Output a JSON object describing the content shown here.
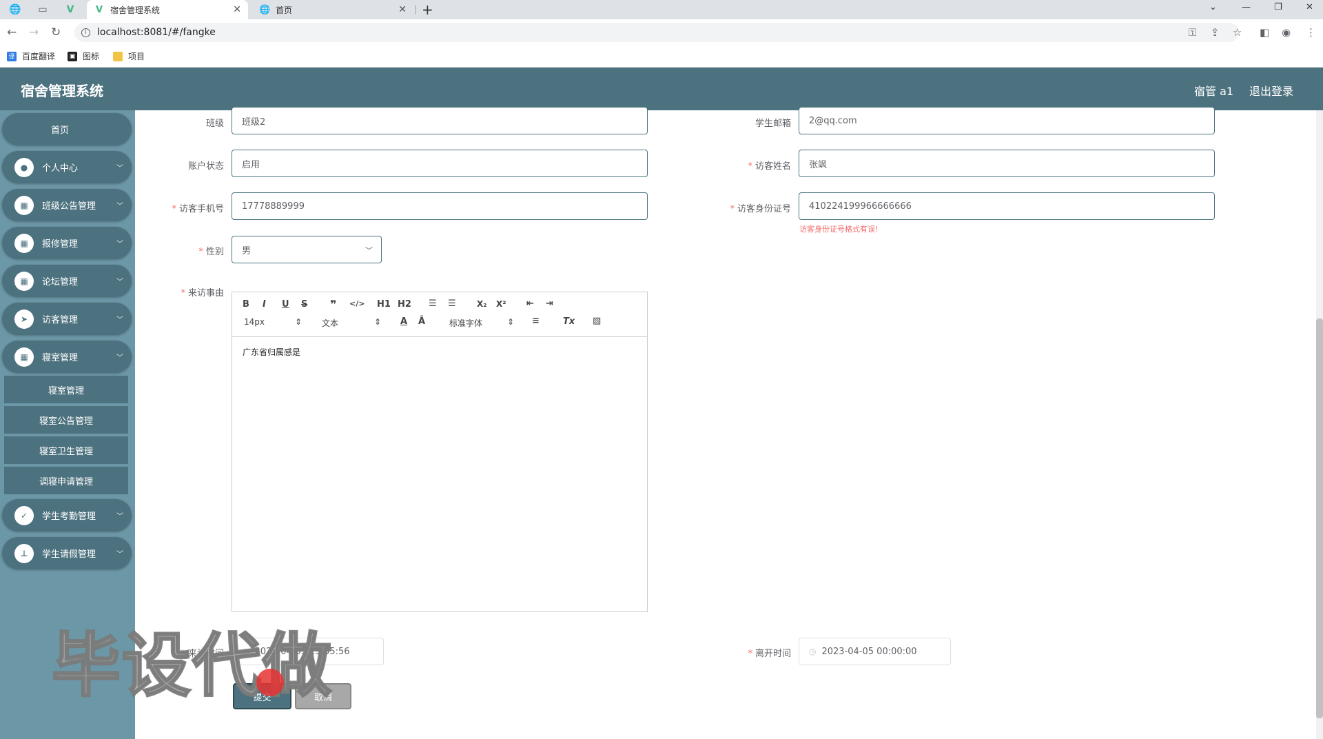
{
  "browser": {
    "tabs": [
      {
        "title": "宿舍管理系统",
        "active": true
      },
      {
        "title": "首页",
        "active": false
      }
    ],
    "url": "localhost:8081/#/fangke",
    "bookmarks": [
      "百度翻译",
      "图标",
      "项目"
    ]
  },
  "header": {
    "title": "宿舍管理系统",
    "user": "宿管 a1",
    "logout": "退出登录"
  },
  "sidebar": {
    "home": "首页",
    "items": [
      {
        "label": "个人中心",
        "icon": "user-icon"
      },
      {
        "label": "班级公告管理",
        "icon": "grid-icon"
      },
      {
        "label": "报修管理",
        "icon": "grid-icon"
      },
      {
        "label": "论坛管理",
        "icon": "grid-icon"
      },
      {
        "label": "访客管理",
        "icon": "send-icon"
      },
      {
        "label": "寝室管理",
        "icon": "grid-icon"
      }
    ],
    "submenu": [
      "寝室管理",
      "寝室公告管理",
      "寝室卫生管理",
      "调寝申请管理"
    ],
    "items_after": [
      {
        "label": "学生考勤管理",
        "icon": "clipboard-icon"
      },
      {
        "label": "学生请假管理",
        "icon": "stamp-icon"
      }
    ]
  },
  "form": {
    "class_label": "班级",
    "class_value": "班级2",
    "email_label": "学生邮箱",
    "email_value": "2@qq.com",
    "status_label": "账户状态",
    "status_value": "启用",
    "visitor_name_label": "访客姓名",
    "visitor_name_value": "张飒",
    "phone_label": "访客手机号",
    "phone_value": "17778889999",
    "id_label": "访客身份证号",
    "id_value": "410224199966666666",
    "id_error": "访客身份证号格式有误!",
    "gender_label": "性别",
    "gender_value": "男",
    "reason_label": "来访事由",
    "reason_value": "广东省归属感是",
    "arrive_label": "来访时间",
    "arrive_value": "2023-04-05 15:55:56",
    "leave_label": "离开时间",
    "leave_value": "2023-04-05 00:00:00",
    "submit": "提交",
    "cancel": "取消"
  },
  "editor_toolbar": {
    "font_size": "14px",
    "block_type": "文本",
    "font_family": "标准字体",
    "h1": "H1",
    "h2": "H2"
  },
  "watermark": "毕设代做"
}
